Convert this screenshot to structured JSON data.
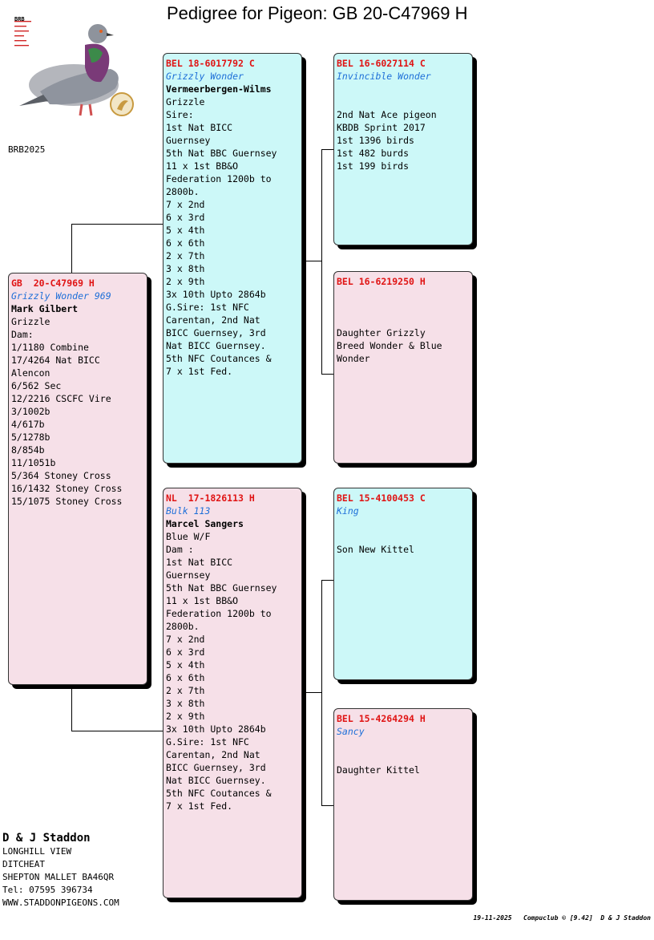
{
  "title": "Pedigree for Pigeon: GB  20-C47969 H",
  "logo": {
    "label": "BRB",
    "year": "BRB2025"
  },
  "subject": {
    "ring": "GB  20-C47969 H",
    "name": "Grizzly Wonder 969",
    "owner": "Mark Gilbert",
    "color": "Grizzle",
    "notes": [
      "Dam:",
      "1/1180 Combine",
      "17/4264 Nat BICC",
      "Alencon",
      "6/562 Sec",
      "12/2216 CSCFC Vire",
      "3/1002b",
      "4/617b",
      "5/1278b",
      "8/854b",
      "11/1051b",
      "5/364 Stoney Cross",
      "16/1432 Stoney Cross",
      "15/1075 Stoney Cross"
    ]
  },
  "sire": {
    "ring": "BEL 18-6017792 C",
    "name": "Grizzly Wonder",
    "owner": "Vermeerbergen-Wilms",
    "color": "Grizzle",
    "notes": [
      "Sire:",
      "1st Nat BICC",
      "Guernsey",
      "5th Nat BBC Guernsey",
      "11 x 1st BB&O",
      "Federation 1200b to",
      "2800b.",
      "7 x 2nd",
      "6 x 3rd",
      "5 x 4th",
      "6 x 6th",
      "2 x 7th",
      "3 x 8th",
      "2 x 9th",
      "3x 10th Upto 2864b",
      "G.Sire: 1st NFC",
      "Carentan, 2nd Nat",
      "BICC Guernsey, 3rd",
      "Nat BICC Guernsey.",
      "5th NFC Coutances &",
      "7 x 1st Fed."
    ]
  },
  "dam": {
    "ring": "NL  17-1826113 H",
    "name": "Bulk 113",
    "owner": "Marcel Sangers",
    "color": "Blue W/F",
    "notes": [
      "Dam :",
      "1st Nat BICC",
      "Guernsey",
      "5th Nat BBC Guernsey",
      "11 x 1st BB&O",
      "Federation 1200b to",
      "2800b.",
      "7 x 2nd",
      "6 x 3rd",
      "5 x 4th",
      "6 x 6th",
      "2 x 7th",
      "3 x 8th",
      "2 x 9th",
      "3x 10th Upto 2864b",
      "G.Sire: 1st NFC",
      "Carentan, 2nd Nat",
      "BICC Guernsey, 3rd",
      "Nat BICC Guernsey.",
      "5th NFC Coutances &",
      "7 x 1st Fed."
    ]
  },
  "sire_sire": {
    "ring": "BEL 16-6027114 C",
    "name": "Invincible Wonder",
    "notes": [
      "2nd Nat Ace pigeon",
      "KBDB Sprint 2017",
      "1st 1396 birds",
      "1st 482 burds",
      "1st 199 birds"
    ]
  },
  "sire_dam": {
    "ring": "BEL 16-6219250 H",
    "name": "",
    "notes": [
      "Daughter Grizzly",
      "Breed Wonder & Blue",
      "Wonder"
    ]
  },
  "dam_sire": {
    "ring": "BEL 15-4100453 C",
    "name": "King",
    "notes": [
      "Son New Kittel"
    ]
  },
  "dam_dam": {
    "ring": "BEL 15-4264294 H",
    "name": "Sancy",
    "notes": [
      "Daughter Kittel"
    ]
  },
  "breeder": {
    "name": "D & J Staddon",
    "lines": [
      "LONGHILL VIEW",
      "DITCHEAT",
      "SHEPTON MALLET BA46QR",
      "Tel: 07595 396734",
      "WWW.STADDONPIGEONS.COM"
    ]
  },
  "footer": "19-11-2025   Compuclub © [9.42]  D & J Staddon"
}
